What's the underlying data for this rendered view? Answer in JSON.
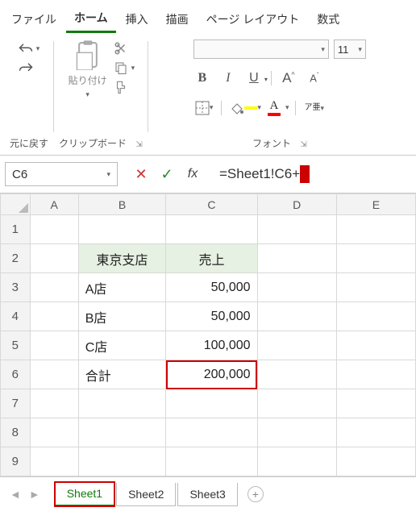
{
  "menu": {
    "file": "ファイル",
    "home": "ホーム",
    "insert": "挿入",
    "draw": "描画",
    "pageLayout": "ページ レイアウト",
    "formulas": "数式"
  },
  "ribbon": {
    "undoGroup": "元に戻す",
    "clipboardGroup": "クリップボード",
    "fontGroup": "フォント",
    "pasteLabel": "貼り付け",
    "fontSize": "11",
    "bold": "B",
    "italic": "I",
    "underline": "U",
    "grow": "A",
    "shrink": "A",
    "fontColorLetter": "A",
    "rubyLabel": "ア亜"
  },
  "formulaBar": {
    "nameBox": "C6",
    "formula": "=Sheet1!C6+"
  },
  "grid": {
    "cols": [
      "A",
      "B",
      "C",
      "D",
      "E"
    ],
    "rows": [
      "1",
      "2",
      "3",
      "4",
      "5",
      "6",
      "7",
      "8",
      "9"
    ],
    "data": {
      "B2": "東京支店",
      "C2": "売上",
      "B3": "A店",
      "C3": "50,000",
      "B4": "B店",
      "C4": "50,000",
      "B5": "C店",
      "C5": "100,000",
      "B6": "合計",
      "C6": "200,000"
    }
  },
  "sheets": {
    "s1": "Sheet1",
    "s2": "Sheet2",
    "s3": "Sheet3"
  }
}
